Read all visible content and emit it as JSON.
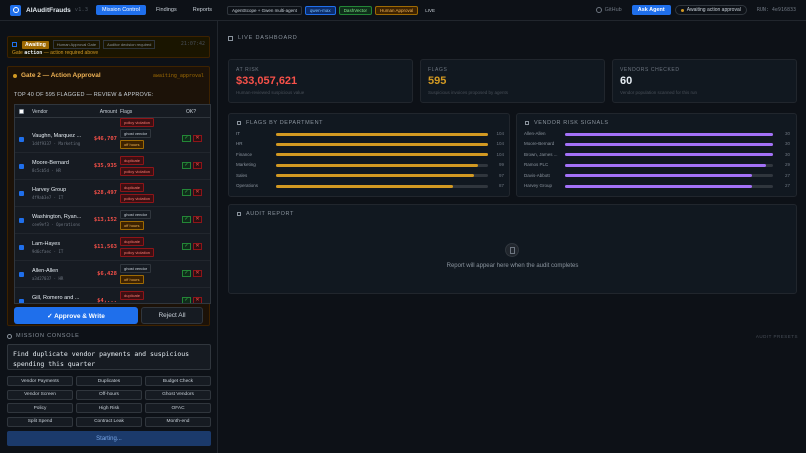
{
  "topbar": {
    "brand": "AIAuditFrauds",
    "version": "v1.3",
    "nav": [
      "Mission Control",
      "Findings",
      "Reports"
    ],
    "chips": [
      "AgentScope + Gwen multi-agent",
      "qwen-max",
      "DashVector",
      "Human Approval",
      "LIVE"
    ],
    "github": "GitHub",
    "ask_agent": "Ask Agent",
    "awaiting": "Awaiting action approval",
    "run": "RUN: 4e916833"
  },
  "gate1": {
    "badge": "Awaiting",
    "tag1": "Human Approval Gate",
    "tag2": "Auditor decision required",
    "time": "21:07:42",
    "message_prefix": "Gate",
    "message_action": "action",
    "message_suffix": "— action required above"
  },
  "gate2": {
    "title": "Gate 2 — Action Approval",
    "status": "awaiting_approval",
    "summary": "TOP 40 OF 595 FLAGGED — REVIEW & APPROVE:",
    "columns": [
      "Vendor",
      "Amount",
      "Flags",
      "OK?"
    ],
    "top_partial_flag": "policy violation",
    "rows": [
      {
        "vendor": "Vaughn, Marquez ...",
        "id": "1d4f9337",
        "dept": "Marketing",
        "amount": "$46,707",
        "flags": [
          "ghost vendor",
          "off hours"
        ]
      },
      {
        "vendor": "Moore-Bernard",
        "id": "8c5cb5d",
        "dept": "HR",
        "amount": "$35,935",
        "flags": [
          "duplicate",
          "policy violation"
        ]
      },
      {
        "vendor": "Harvey Group",
        "id": "4f9ab3e7",
        "dept": "IT",
        "amount": "$28,497",
        "flags": [
          "duplicate",
          "policy violation"
        ]
      },
      {
        "vendor": "Washington, Ryan...",
        "id": "cee9ef3",
        "dept": "Operations",
        "amount": "$13,152",
        "flags": [
          "ghost vendor",
          "off hours"
        ]
      },
      {
        "vendor": "Lam-Hayes",
        "id": "9d6cfaec",
        "dept": "IT",
        "amount": "$11,563",
        "flags": [
          "duplicate",
          "policy violation"
        ]
      },
      {
        "vendor": "Allen-Allen",
        "id": "a3d27037",
        "dept": "HR",
        "amount": "$6,428",
        "flags": [
          "ghost vendor",
          "off hours"
        ]
      },
      {
        "vendor": "Gill, Romero and ...",
        "id": "",
        "dept": "",
        "amount": "$4,...",
        "flags": [
          "duplicate"
        ]
      }
    ],
    "ok_symbol": "✓",
    "reject_symbol": "✕",
    "approve_label": "✓ Approve & Write",
    "reject_label": "Reject All"
  },
  "mission": {
    "title": "MISSION CONSOLE",
    "presets_label": "AUDIT PRESETS",
    "query": "Find duplicate vendor payments and suspicious spending this quarter",
    "presets": [
      "Vendor Payments",
      "Duplicates",
      "Budget Check",
      "Vendor Screen",
      "Off-hours",
      "Ghost Vendors",
      "Policy",
      "High Risk",
      "OFAC",
      "Split Spend",
      "Contract Leak",
      "Month-end"
    ],
    "starting": "Starting..."
  },
  "dashboard": {
    "title": "LIVE DASHBOARD",
    "stats": [
      {
        "label": "AT RISK",
        "value": "$33,057,621",
        "sub": "Human-reviewed suspicious value",
        "color": "#f85149"
      },
      {
        "label": "FLAGS",
        "value": "595",
        "sub": "Suspicious invoices proposed by agents",
        "color": "#d29922"
      },
      {
        "label": "VENDORS CHECKED",
        "value": "60",
        "sub": "Vendor population scanned for this run",
        "color": "#e6edf3"
      }
    ],
    "dept_title": "FLAGS BY DEPARTMENT",
    "dept_max": 104,
    "departments": [
      {
        "name": "IT",
        "value": 104
      },
      {
        "name": "HR",
        "value": 104
      },
      {
        "name": "Finance",
        "value": 104
      },
      {
        "name": "Marketing",
        "value": 99
      },
      {
        "name": "Sales",
        "value": 97
      },
      {
        "name": "Operations",
        "value": 87
      }
    ],
    "vendor_title": "VENDOR RISK SIGNALS",
    "vendor_max": 30,
    "vendors": [
      {
        "name": "Allen-Allen",
        "value": 30
      },
      {
        "name": "Moore-Bernard",
        "value": 30
      },
      {
        "name": "Brown, James ...",
        "value": 30
      },
      {
        "name": "Ramos PLC",
        "value": 29
      },
      {
        "name": "Davis-Abbott",
        "value": 27
      },
      {
        "name": "Harvey Group",
        "value": 27
      }
    ],
    "audit_title": "AUDIT REPORT",
    "audit_empty": "Report will appear here when the audit completes",
    "colors": {
      "dept_bar": "#d29922",
      "vendor_bar": "#a371f7"
    }
  }
}
